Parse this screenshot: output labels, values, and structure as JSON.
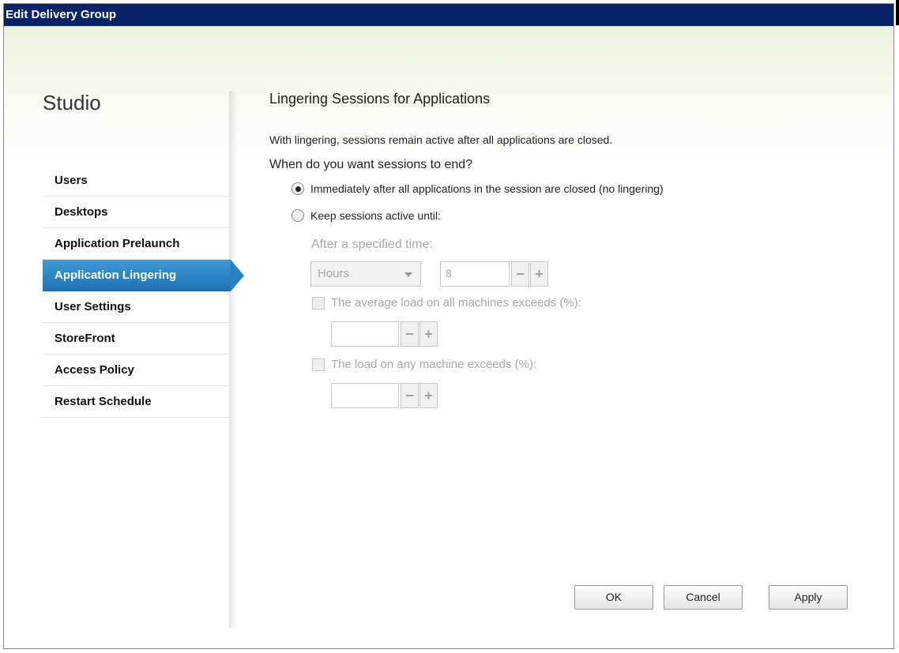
{
  "window": {
    "title": "Edit Delivery Group"
  },
  "app": {
    "name": "Studio"
  },
  "sidebar": {
    "items": [
      {
        "label": "Users"
      },
      {
        "label": "Desktops"
      },
      {
        "label": "Application Prelaunch"
      },
      {
        "label": "Application Lingering",
        "active": true
      },
      {
        "label": "User Settings"
      },
      {
        "label": "StoreFront"
      },
      {
        "label": "Access Policy"
      },
      {
        "label": "Restart Schedule"
      }
    ]
  },
  "main": {
    "heading": "Lingering Sessions for Applications",
    "intro": "With lingering, sessions remain active after all applications are closed.",
    "question": "When do you want sessions to end?",
    "option_immediate": {
      "label": "Immediately after all applications in the session are closed (no lingering)",
      "selected": true
    },
    "option_keep": {
      "label": "Keep sessions active until:",
      "selected": false
    },
    "time_label": "After a specified time:",
    "time_unit": "Hours",
    "time_value": "8",
    "avg_load": {
      "label": "The average load on all machines exceeds (%):",
      "checked": false,
      "value": ""
    },
    "any_load": {
      "label": "The load on any machine exceeds (%):",
      "checked": false,
      "value": ""
    },
    "stepper_minus": "−",
    "stepper_plus": "+"
  },
  "footer": {
    "ok": "OK",
    "cancel": "Cancel",
    "apply": "Apply"
  },
  "colors": {
    "titlebar": "#0a246a",
    "active_nav": "#2882c2",
    "disabled_text": "#a8a8a8"
  }
}
